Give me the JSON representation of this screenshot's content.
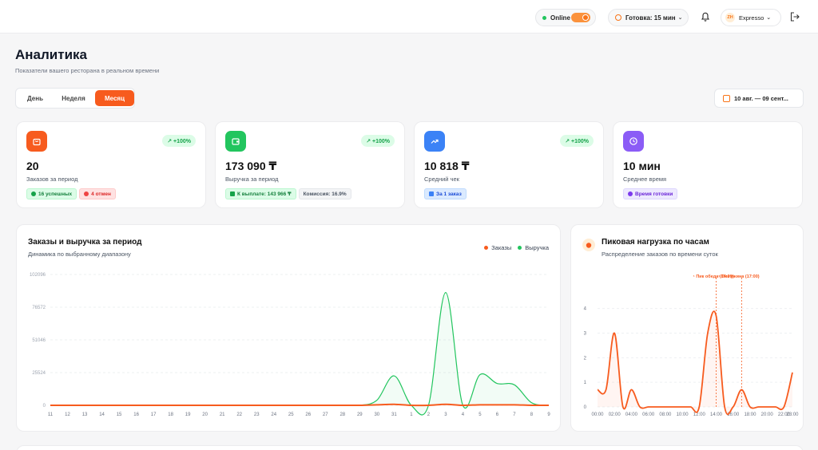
{
  "topbar": {
    "online_label": "Online",
    "ready_label": "Готовка: 15 мин",
    "user_initials": "ZH",
    "user_name": "Expresso"
  },
  "page": {
    "title": "Аналитика",
    "subtitle": "Показатели вашего ресторана в реальном времени"
  },
  "period_tabs": [
    {
      "label": "День",
      "active": false
    },
    {
      "label": "Неделя",
      "active": false
    },
    {
      "label": "Месяц",
      "active": true
    }
  ],
  "date_range": "10 авг. — 09 сент...",
  "stats": [
    {
      "icon": "bag-icon",
      "color": "#f75b1e",
      "trend": "↗ +100%",
      "value": "20",
      "label": "Заказов за период",
      "badges": [
        {
          "text": "16 успешных",
          "style": "green"
        },
        {
          "text": "4 отмен",
          "style": "red"
        }
      ]
    },
    {
      "icon": "wallet-icon",
      "color": "#22c55e",
      "trend": "↗ +100%",
      "value": "173 090 ₸",
      "label": "Выручка за период",
      "badges": [
        {
          "text": "К выплате: 143 966 ₸",
          "style": "green"
        },
        {
          "text": "Комиссия: 16.9%",
          "style": "gray"
        }
      ]
    },
    {
      "icon": "trending-up-icon",
      "color": "#3b82f6",
      "trend": "↗ +100%",
      "value": "10 818 ₸",
      "label": "Средний чек",
      "badges": [
        {
          "text": "За 1 заказ",
          "style": "blue"
        }
      ]
    },
    {
      "icon": "clock-icon",
      "color": "#8b5cf6",
      "trend": "",
      "value": "10 мин",
      "label": "Среднее время",
      "badges": [
        {
          "text": "Время готовки",
          "style": "purple"
        }
      ]
    }
  ],
  "orders_chart": {
    "title": "Заказы и выручка за период",
    "subtitle": "Динамика по выбранному диапазону",
    "legend": [
      "Заказы",
      "Выручка"
    ]
  },
  "peak_chart": {
    "title": "Пиковая нагрузка по часам",
    "subtitle": "Распределение заказов по времени суток",
    "annotation_1": "Пик обеда (14:00)",
    "annotation_2": "Пик ужина (17:00)"
  },
  "chart_data": [
    {
      "type": "area",
      "title": "Заказы и выручка за период",
      "x": [
        "11",
        "12",
        "13",
        "14",
        "15",
        "16",
        "17",
        "18",
        "19",
        "20",
        "21",
        "22",
        "23",
        "24",
        "25",
        "26",
        "27",
        "28",
        "29",
        "30",
        "31",
        "1",
        "2",
        "3",
        "4",
        "5",
        "6",
        "7",
        "8",
        "9"
      ],
      "y_ticks": [
        "0",
        "25524",
        "51046",
        "76572",
        "102096"
      ],
      "ylim": [
        0,
        102096
      ],
      "series": [
        {
          "name": "Заказы",
          "color": "#f75b1e",
          "values": [
            0,
            0,
            0,
            0,
            0,
            0,
            0,
            0,
            0,
            0,
            0,
            0,
            0,
            0,
            0,
            0,
            0,
            0,
            0,
            1,
            2,
            0,
            0,
            2,
            0,
            1,
            1,
            1,
            0,
            0
          ]
        },
        {
          "name": "Выручка",
          "color": "#22c55e",
          "values": [
            0,
            0,
            0,
            0,
            0,
            0,
            0,
            0,
            0,
            0,
            0,
            0,
            0,
            0,
            0,
            0,
            0,
            0,
            0,
            4000,
            23000,
            0,
            0,
            88000,
            0,
            24000,
            17000,
            16000,
            2000,
            0
          ]
        }
      ],
      "legend_position": "top-right",
      "grid": true
    },
    {
      "type": "area",
      "title": "Пиковая нагрузка по часам",
      "x_ticks": [
        "00:00",
        "02:00",
        "04:00",
        "06:00",
        "08:00",
        "10:00",
        "12:00",
        "14:00",
        "16:00",
        "18:00",
        "20:00",
        "22:00",
        "23:00"
      ],
      "y_ticks": [
        "0",
        "1",
        "2",
        "3",
        "4"
      ],
      "ylim": [
        0,
        4.8
      ],
      "hours": [
        0,
        1,
        2,
        3,
        4,
        5,
        6,
        7,
        8,
        9,
        10,
        11,
        12,
        13,
        14,
        15,
        16,
        17,
        18,
        19,
        20,
        21,
        22,
        23
      ],
      "series": [
        {
          "color": "#f75b1e",
          "values": [
            0.7,
            0.7,
            3,
            0,
            0.7,
            0,
            0,
            0,
            0,
            0,
            0,
            0,
            0,
            3,
            3.7,
            0,
            0,
            0.7,
            0,
            0,
            0,
            0,
            0,
            1.4
          ]
        }
      ],
      "markers": [
        14,
        17
      ],
      "grid": true
    }
  ]
}
